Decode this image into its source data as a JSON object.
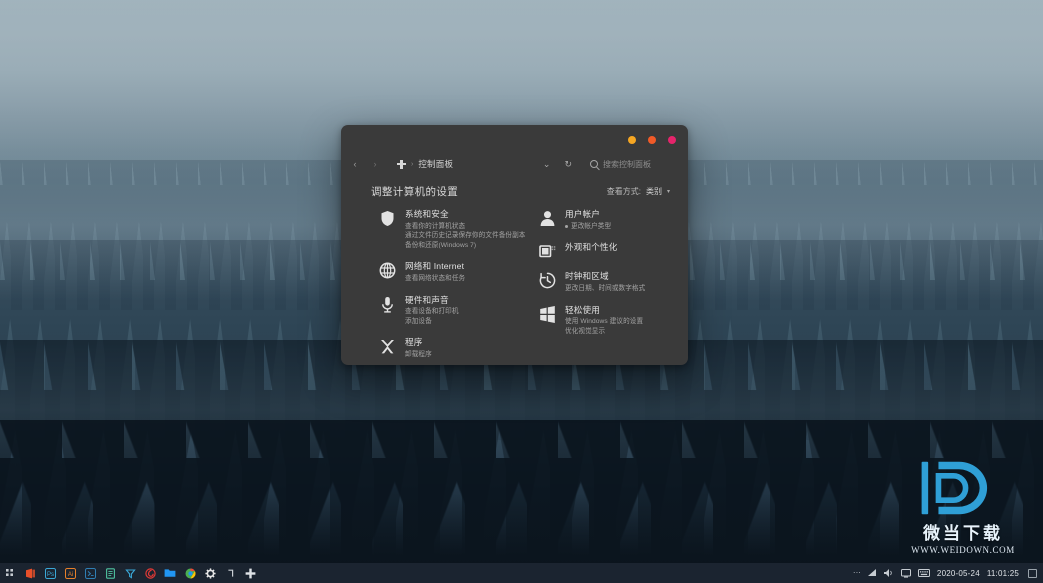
{
  "window": {
    "traffic_lights": [
      {
        "name": "minimize",
        "color": "#f5a623"
      },
      {
        "name": "maximize",
        "color": "#f05a28"
      },
      {
        "name": "close",
        "color": "#e5246b"
      }
    ],
    "nav": {
      "back": "‹",
      "forward": "›"
    },
    "breadcrumb": {
      "icon": "control-panel-icon",
      "separator": "›",
      "text": "控制面板"
    },
    "toolbar": {
      "history_caret": "⌄",
      "refresh": "↻"
    },
    "search": {
      "icon": "search-icon",
      "placeholder": "搜索控制面板",
      "value": ""
    },
    "page_title": "调整计算机的设置",
    "view_by": {
      "label": "查看方式:",
      "value": "类别",
      "caret": "▾"
    }
  },
  "categories": {
    "left": [
      {
        "icon": "shield-icon",
        "title": "系统和安全",
        "links": [
          {
            "text": "查看你的计算机状态",
            "bullet": false
          },
          {
            "text": "通过文件历史记录保存你的文件备份副本",
            "bullet": false
          },
          {
            "text": "备份和还原(Windows 7)",
            "bullet": false
          }
        ]
      },
      {
        "icon": "globe-icon",
        "title": "网络和 Internet",
        "links": [
          {
            "text": "查看网络状态和任务",
            "bullet": false
          }
        ]
      },
      {
        "icon": "microphone-icon",
        "title": "硬件和声音",
        "links": [
          {
            "text": "查看设备和打印机",
            "bullet": false
          },
          {
            "text": "添加设备",
            "bullet": false
          }
        ]
      },
      {
        "icon": "programs-x-icon",
        "title": "程序",
        "links": [
          {
            "text": "卸载程序",
            "bullet": false
          }
        ]
      }
    ],
    "right": [
      {
        "icon": "user-icon",
        "title": "用户帐户",
        "links": [
          {
            "text": "更改帐户类型",
            "bullet": true
          }
        ]
      },
      {
        "icon": "appearance-icon",
        "title": "外观和个性化",
        "links": []
      },
      {
        "icon": "clock-icon",
        "title": "时钟和区域",
        "links": [
          {
            "text": "更改日期、时间或数字格式",
            "bullet": false
          }
        ]
      },
      {
        "icon": "ease-of-access-icon",
        "title": "轻松使用",
        "links": [
          {
            "text": "使用 Windows 建议的设置",
            "bullet": false
          },
          {
            "text": "优化视觉显示",
            "bullet": false
          }
        ]
      }
    ]
  },
  "watermark": {
    "logo": "weidown-d-logo",
    "cn_name": "微当下载",
    "url": "WWW.WEIDOWN.COM"
  },
  "taskbar": {
    "start": {
      "name": "start-grid-icon"
    },
    "pinned": [
      {
        "name": "taskbar-item-office",
        "color": "#e8502a"
      },
      {
        "name": "taskbar-item-photoshop",
        "color": "#3aa8d8"
      },
      {
        "name": "taskbar-item-illustrator",
        "color": "#e8802a"
      },
      {
        "name": "taskbar-item-terminal",
        "color": "#2f7fb5"
      },
      {
        "name": "taskbar-item-notes",
        "color": "#4fc3a1"
      },
      {
        "name": "taskbar-item-clipper",
        "color": "#3aa8d8"
      },
      {
        "name": "taskbar-item-thunder",
        "color": "#e53935"
      },
      {
        "name": "taskbar-item-explorer",
        "color": "#2196f3"
      },
      {
        "name": "taskbar-item-chrome",
        "color": "#e8502a"
      },
      {
        "name": "taskbar-item-settings",
        "color": "#e6e6e6"
      },
      {
        "name": "taskbar-item-unknown",
        "color": "#c9ced3"
      },
      {
        "name": "taskbar-item-controlpanel",
        "color": "#dfe3e7"
      }
    ],
    "tray": [
      {
        "name": "tray-overflow-icon",
        "glyph": "···"
      },
      {
        "name": "tray-network-icon",
        "glyph": "◢"
      },
      {
        "name": "tray-volume-icon",
        "glyph": "🔊"
      },
      {
        "name": "tray-display-icon",
        "glyph": "⬜"
      },
      {
        "name": "tray-keyboard-icon",
        "glyph": "⌨"
      }
    ],
    "date": "2020-05-24",
    "time": "11:01:25",
    "show_desktop": "show-desktop-button"
  }
}
